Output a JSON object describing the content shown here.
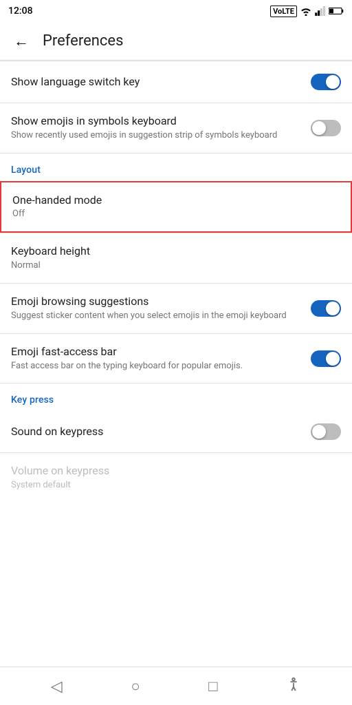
{
  "statusBar": {
    "time": "12:08",
    "icons": [
      "volte",
      "wifi",
      "signal",
      "battery"
    ]
  },
  "appBar": {
    "backLabel": "←",
    "title": "Preferences"
  },
  "sections": [
    {
      "type": "settings",
      "items": [
        {
          "id": "show-language-switch",
          "title": "Show language switch key",
          "subtitle": null,
          "control": "toggle",
          "state": "on"
        },
        {
          "id": "show-emojis-symbols",
          "title": "Show emojis in symbols keyboard",
          "subtitle": "Show recently used emojis in suggestion strip of symbols keyboard",
          "control": "toggle",
          "state": "off"
        }
      ]
    },
    {
      "type": "header",
      "label": "Layout"
    },
    {
      "type": "settings",
      "items": [
        {
          "id": "one-handed-mode",
          "title": "One-handed mode",
          "subtitle": "Off",
          "control": "none",
          "state": null,
          "highlighted": true
        },
        {
          "id": "keyboard-height",
          "title": "Keyboard height",
          "subtitle": "Normal",
          "control": "none",
          "state": null,
          "highlighted": false
        },
        {
          "id": "emoji-browsing",
          "title": "Emoji browsing suggestions",
          "subtitle": "Suggest sticker content when you select emojis in the emoji keyboard",
          "control": "toggle",
          "state": "on"
        },
        {
          "id": "emoji-fast-access",
          "title": "Emoji fast-access bar",
          "subtitle": "Fast access bar on the typing keyboard for popular emojis.",
          "control": "toggle",
          "state": "on"
        }
      ]
    },
    {
      "type": "header",
      "label": "Key press"
    },
    {
      "type": "settings",
      "items": [
        {
          "id": "sound-on-keypress",
          "title": "Sound on keypress",
          "subtitle": null,
          "control": "toggle",
          "state": "off"
        },
        {
          "id": "volume-on-keypress",
          "title": "Volume on keypress",
          "subtitle": "System default",
          "control": "none",
          "state": null,
          "disabled": true
        }
      ]
    }
  ],
  "bottomNav": {
    "back": "◁",
    "home": "○",
    "recents": "□",
    "accessibility": "♿"
  }
}
